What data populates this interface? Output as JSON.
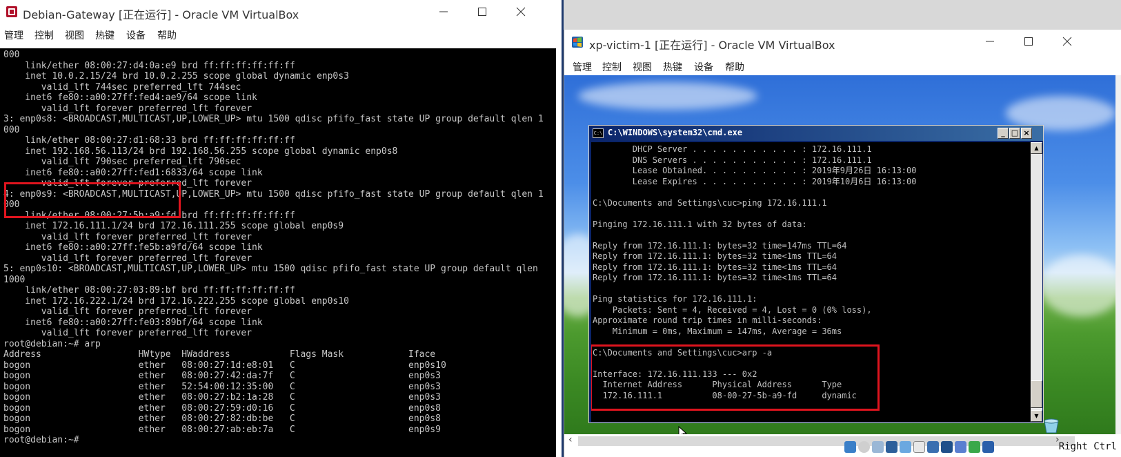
{
  "left_window": {
    "title": "Debian-Gateway [正在运行] - Oracle VM VirtualBox",
    "menu": [
      "管理",
      "控制",
      "视图",
      "热键",
      "设备",
      "帮助"
    ],
    "terminal_lines": [
      "000",
      "    link/ether 08:00:27:d4:0a:e9 brd ff:ff:ff:ff:ff:ff",
      "    inet 10.0.2.15/24 brd 10.0.2.255 scope global dynamic enp0s3",
      "       valid_lft 744sec preferred_lft 744sec",
      "    inet6 fe80::a00:27ff:fed4:ae9/64 scope link",
      "       valid_lft forever preferred_lft forever",
      "3: enp0s8: <BROADCAST,MULTICAST,UP,LOWER_UP> mtu 1500 qdisc pfifo_fast state UP group default qlen 1",
      "000",
      "    link/ether 08:00:27:d1:68:33 brd ff:ff:ff:ff:ff:ff",
      "    inet 192.168.56.113/24 brd 192.168.56.255 scope global dynamic enp0s8",
      "       valid_lft 790sec preferred_lft 790sec",
      "    inet6 fe80::a00:27ff:fed1:6833/64 scope link",
      "       valid_lft forever preferred_lft forever",
      "4: enp0s9: <BROADCAST,MULTICAST,UP,LOWER_UP> mtu 1500 qdisc pfifo_fast state UP group default qlen 1",
      "000",
      "    link/ether 08:00:27:5b:a9:fd brd ff:ff:ff:ff:ff:ff",
      "    inet 172.16.111.1/24 brd 172.16.111.255 scope global enp0s9",
      "       valid_lft forever preferred_lft forever",
      "    inet6 fe80::a00:27ff:fe5b:a9fd/64 scope link",
      "       valid_lft forever preferred_lft forever",
      "5: enp0s10: <BROADCAST,MULTICAST,UP,LOWER_UP> mtu 1500 qdisc pfifo_fast state UP group default qlen",
      "1000",
      "    link/ether 08:00:27:03:89:bf brd ff:ff:ff:ff:ff:ff",
      "    inet 172.16.222.1/24 brd 172.16.222.255 scope global enp0s10",
      "       valid_lft forever preferred_lft forever",
      "    inet6 fe80::a00:27ff:fe03:89bf/64 scope link",
      "       valid_lft forever preferred_lft forever",
      "root@debian:~# arp",
      "Address                  HWtype  HWaddress           Flags Mask            Iface",
      "bogon                    ether   08:00:27:1d:e8:01   C                     enp0s10",
      "bogon                    ether   08:00:27:42:da:7f   C                     enp0s3",
      "bogon                    ether   52:54:00:12:35:00   C                     enp0s3",
      "bogon                    ether   08:00:27:b2:1a:28   C                     enp0s3",
      "bogon                    ether   08:00:27:59:d0:16   C                     enp0s8",
      "bogon                    ether   08:00:27:82:db:be   C                     enp0s8",
      "bogon                    ether   08:00:27:ab:eb:7a   C                     enp0s9",
      "root@debian:~#"
    ]
  },
  "right_window": {
    "title": "xp-victim-1 [正在运行] - Oracle VM VirtualBox",
    "menu": [
      "管理",
      "控制",
      "视图",
      "热键",
      "设备",
      "帮助"
    ],
    "cmd": {
      "title": "C:\\WINDOWS\\system32\\cmd.exe",
      "icon_text": "C:\\",
      "lines": [
        "        DHCP Server . . . . . . . . . . . : 172.16.111.1",
        "        DNS Servers . . . . . . . . . . . : 172.16.111.1",
        "        Lease Obtained. . . . . . . . . . : 2019年9月26日 16:13:00",
        "        Lease Expires . . . . . . . . . . : 2019年10月6日 16:13:00",
        "",
        "C:\\Documents and Settings\\cuc>ping 172.16.111.1",
        "",
        "Pinging 172.16.111.1 with 32 bytes of data:",
        "",
        "Reply from 172.16.111.1: bytes=32 time=147ms TTL=64",
        "Reply from 172.16.111.1: bytes=32 time<1ms TTL=64",
        "Reply from 172.16.111.1: bytes=32 time<1ms TTL=64",
        "Reply from 172.16.111.1: bytes=32 time<1ms TTL=64",
        "",
        "Ping statistics for 172.16.111.1:",
        "    Packets: Sent = 4, Received = 4, Lost = 0 (0% loss),",
        "Approximate round trip times in milli-seconds:",
        "    Minimum = 0ms, Maximum = 147ms, Average = 36ms",
        "",
        "C:\\Documents and Settings\\cuc>arp -a",
        "",
        "Interface: 172.16.111.133 --- 0x2",
        "  Internet Address      Physical Address      Type",
        "  172.16.111.1          08-00-27-5b-a9-fd     dynamic"
      ]
    },
    "host_key": "Right Ctrl"
  },
  "colors": {
    "highlight_box": "#e0141e",
    "terminal_bg": "#000000",
    "terminal_fg": "#c8c8c8",
    "xp_title_blue": "#0a246a"
  },
  "status_icons": [
    "hard-disk-icon",
    "optical-drive-icon",
    "audio-icon",
    "network-icon",
    "usb-icon",
    "shared-folder-icon",
    "display-icon",
    "recording-icon",
    "cpu-icon",
    "mouse-integration-icon",
    "keyboard-icon"
  ]
}
